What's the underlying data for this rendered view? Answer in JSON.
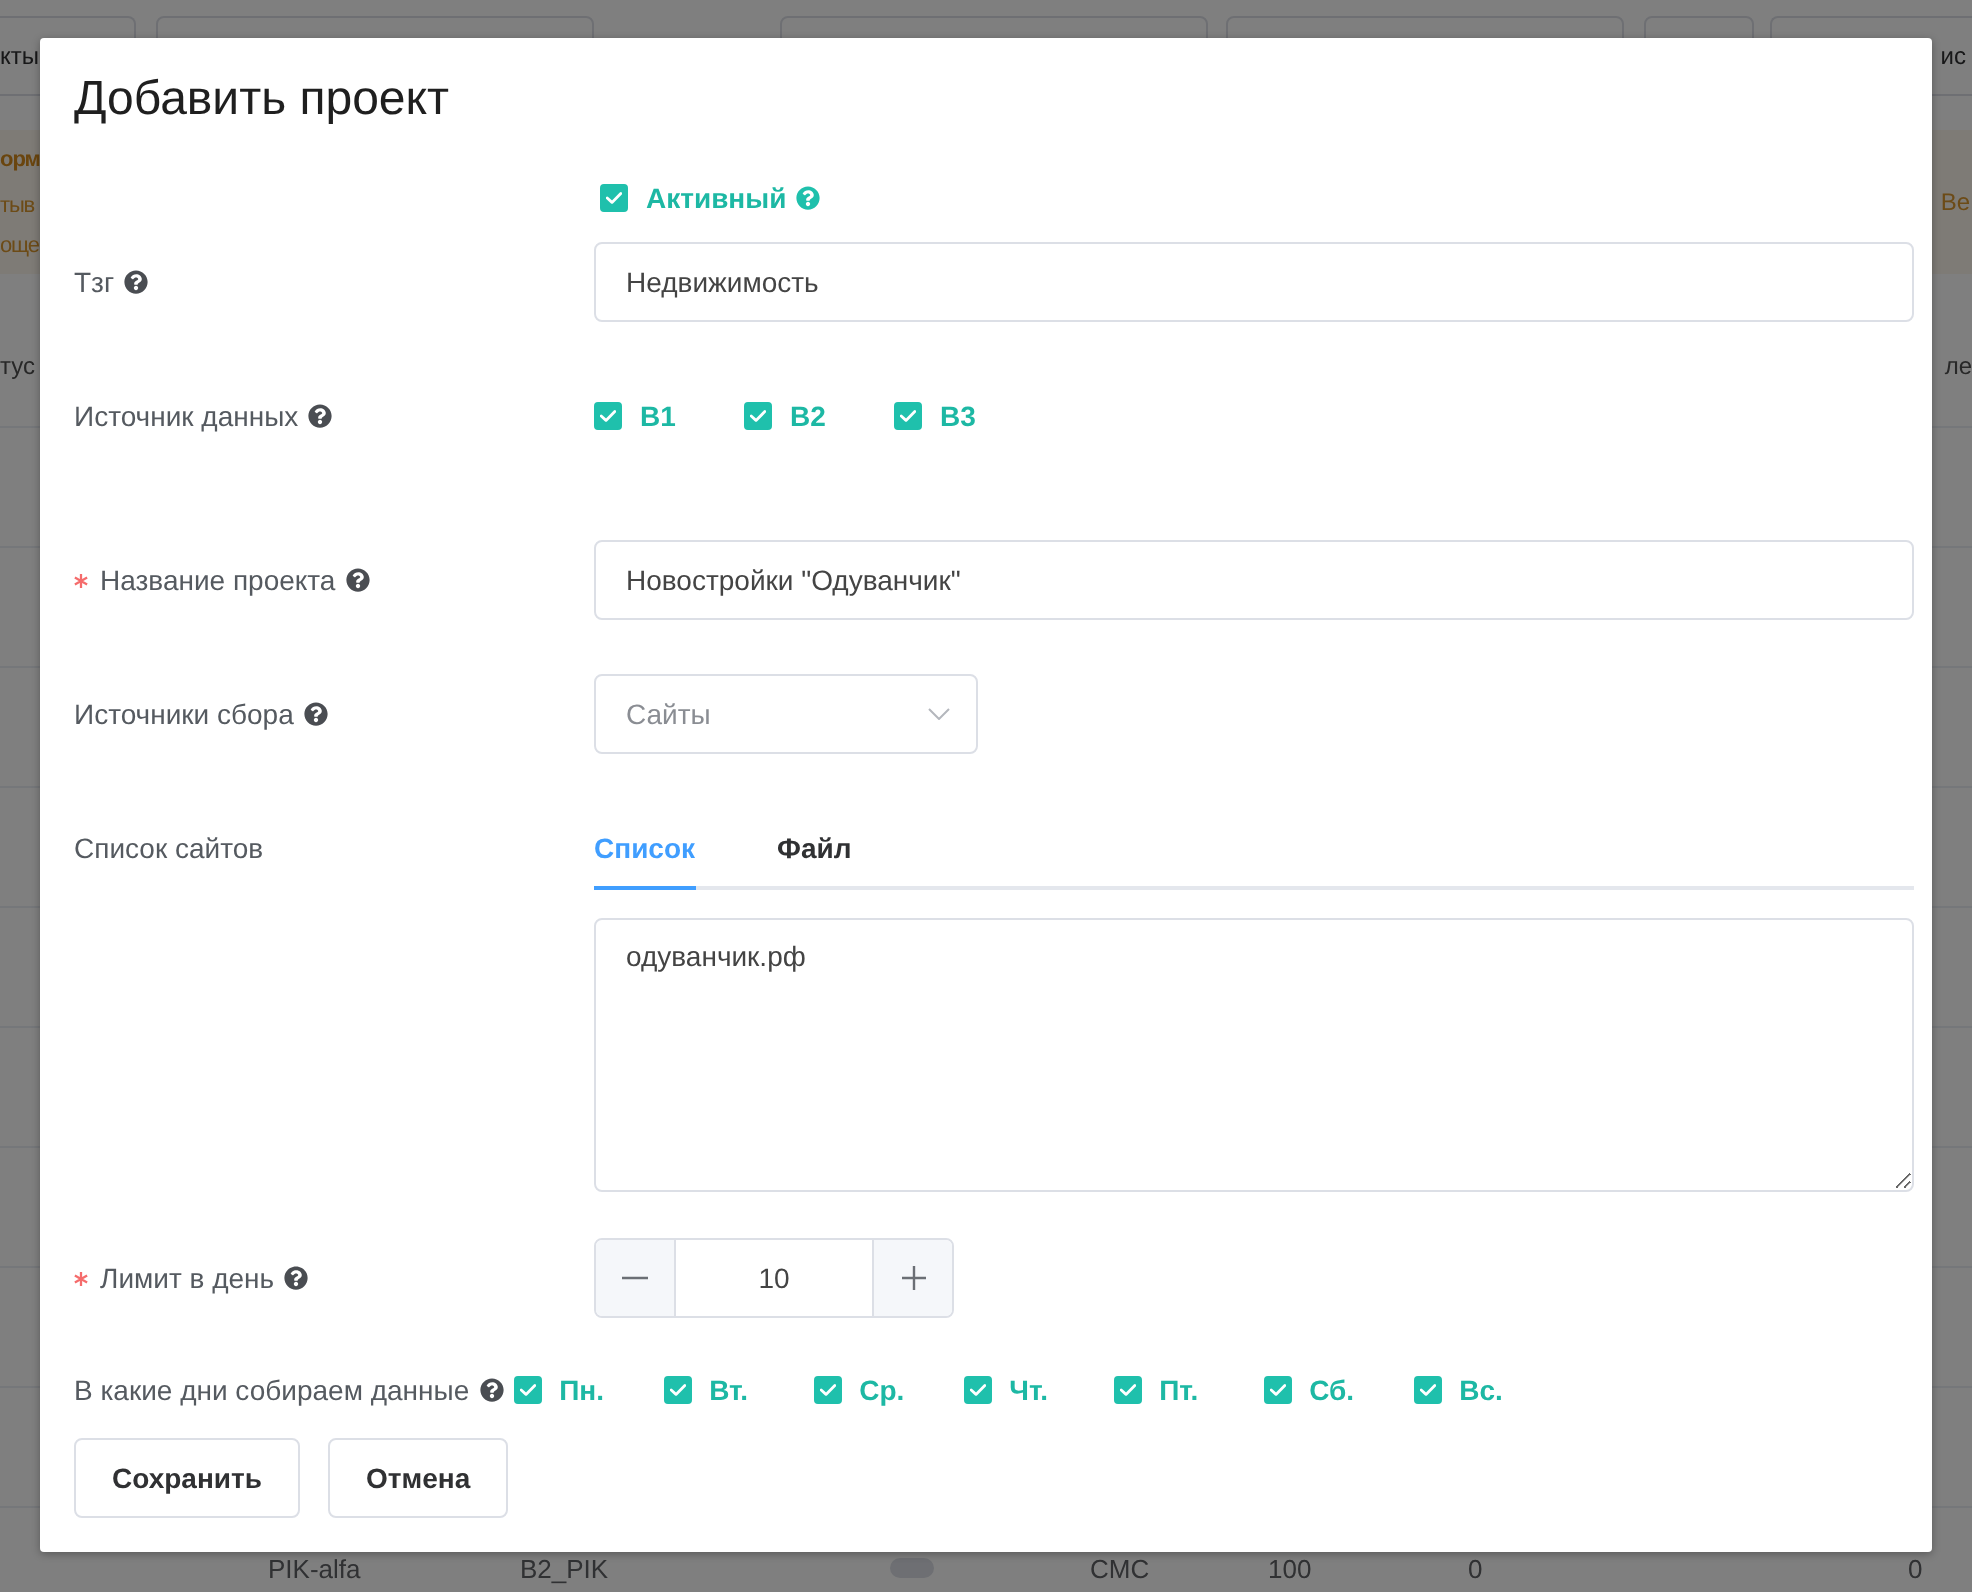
{
  "background": {
    "toolbar": {
      "first_item": "кты",
      "last_item": "ис"
    },
    "notice": {
      "title": "орм",
      "lines": [
        "тыв",
        "още"
      ],
      "right_text": "Ве"
    },
    "table": {
      "header_first": "тус",
      "header_last": "ле",
      "last_row": [
        "PIK-alfa",
        "B2_PIK",
        "CMC",
        "100",
        "0",
        "0"
      ]
    }
  },
  "dialog": {
    "title": "Добавить проект",
    "active": {
      "label": "Активный",
      "checked": true,
      "help": true
    },
    "fields": [
      {
        "kind": "text",
        "label": "Тзг",
        "required": false,
        "help": true,
        "value": "Недвижимость"
      },
      {
        "kind": "checkboxes",
        "label": "Источник данных",
        "required": false,
        "help": true,
        "options": [
          {
            "label": "B1",
            "checked": true
          },
          {
            "label": "B2",
            "checked": true
          },
          {
            "label": "B3",
            "checked": true
          }
        ]
      },
      {
        "kind": "text",
        "label": "Название проекта",
        "required": true,
        "help": true,
        "value": "Новостройки \"Одуванчик\""
      },
      {
        "kind": "select",
        "label": "Источники сбора",
        "required": false,
        "help": true,
        "placeholder": "Сайты"
      },
      {
        "kind": "tabs",
        "label": "Список сайтов",
        "required": false,
        "help": false,
        "tabs": [
          {
            "label": "Список",
            "selected": true
          },
          {
            "label": "Файл",
            "selected": false
          }
        ],
        "value": "одуванчик.рф"
      },
      {
        "kind": "number",
        "label": "Лимит в день",
        "required": true,
        "help": true,
        "value": "10"
      },
      {
        "kind": "days",
        "label": "В какие дни собираем данные",
        "required": false,
        "help": true,
        "options": [
          {
            "label": "Пн.",
            "checked": true
          },
          {
            "label": "Вт.",
            "checked": true
          },
          {
            "label": "Ср.",
            "checked": true
          },
          {
            "label": "Чт.",
            "checked": true
          },
          {
            "label": "Пт.",
            "checked": true
          },
          {
            "label": "Сб.",
            "checked": true
          },
          {
            "label": "Вс.",
            "checked": true
          }
        ]
      }
    ],
    "buttons": [
      "Сохранить",
      "Отмена"
    ]
  }
}
